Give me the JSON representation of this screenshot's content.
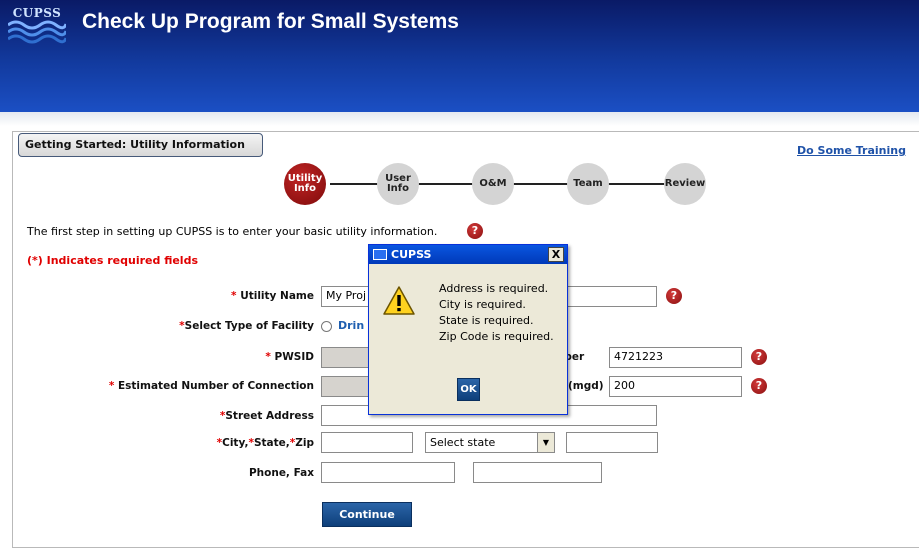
{
  "header": {
    "logo_text": "CUPSS",
    "title": "Check Up Program for Small Systems",
    "color_dark": "#0a1a66",
    "color_light": "#1b4fc4"
  },
  "section": {
    "tab_label": "Getting Started: Utility Information",
    "training_link": "Do Some Training"
  },
  "stepper": {
    "steps": [
      {
        "label_line1": "Utility",
        "label_line2": "Info",
        "active": true
      },
      {
        "label_line1": "User",
        "label_line2": "Info",
        "active": false
      },
      {
        "label_line1": "O&M",
        "label_line2": "",
        "active": false
      },
      {
        "label_line1": "Team",
        "label_line2": "",
        "active": false
      },
      {
        "label_line1": "Review",
        "label_line2": "",
        "active": false
      }
    ],
    "active_color": "#9b1414"
  },
  "form": {
    "intro": "The first step in setting up CUPSS is to enter your basic utility information.",
    "required_note": "(*) Indicates required fields",
    "help_icon": "?",
    "labels": {
      "utility_name": "Utility Name",
      "facility_type": "Select Type of Facility",
      "pwsid": "PWSID",
      "connections": "Estimated Number of Connection",
      "street": "Street Address",
      "city": "City,",
      "state": "State,",
      "zip": "Zip",
      "phone_fax": "Phone, Fax",
      "number_suffix": "umber",
      "mgd_suffix": "(mgd)",
      "req": "*"
    },
    "values": {
      "utility_name": "My Proj",
      "facility_option": "Drin",
      "number": "4721223",
      "mgd": "200",
      "state_select": "Select state"
    },
    "continue_label": "Continue"
  },
  "dialog": {
    "title": "CUPSS",
    "close": "X",
    "messages": [
      "Address is required.",
      "City is required.",
      "State is required.",
      "Zip Code is required."
    ],
    "ok_label": "OK",
    "icon": "warning-icon"
  }
}
